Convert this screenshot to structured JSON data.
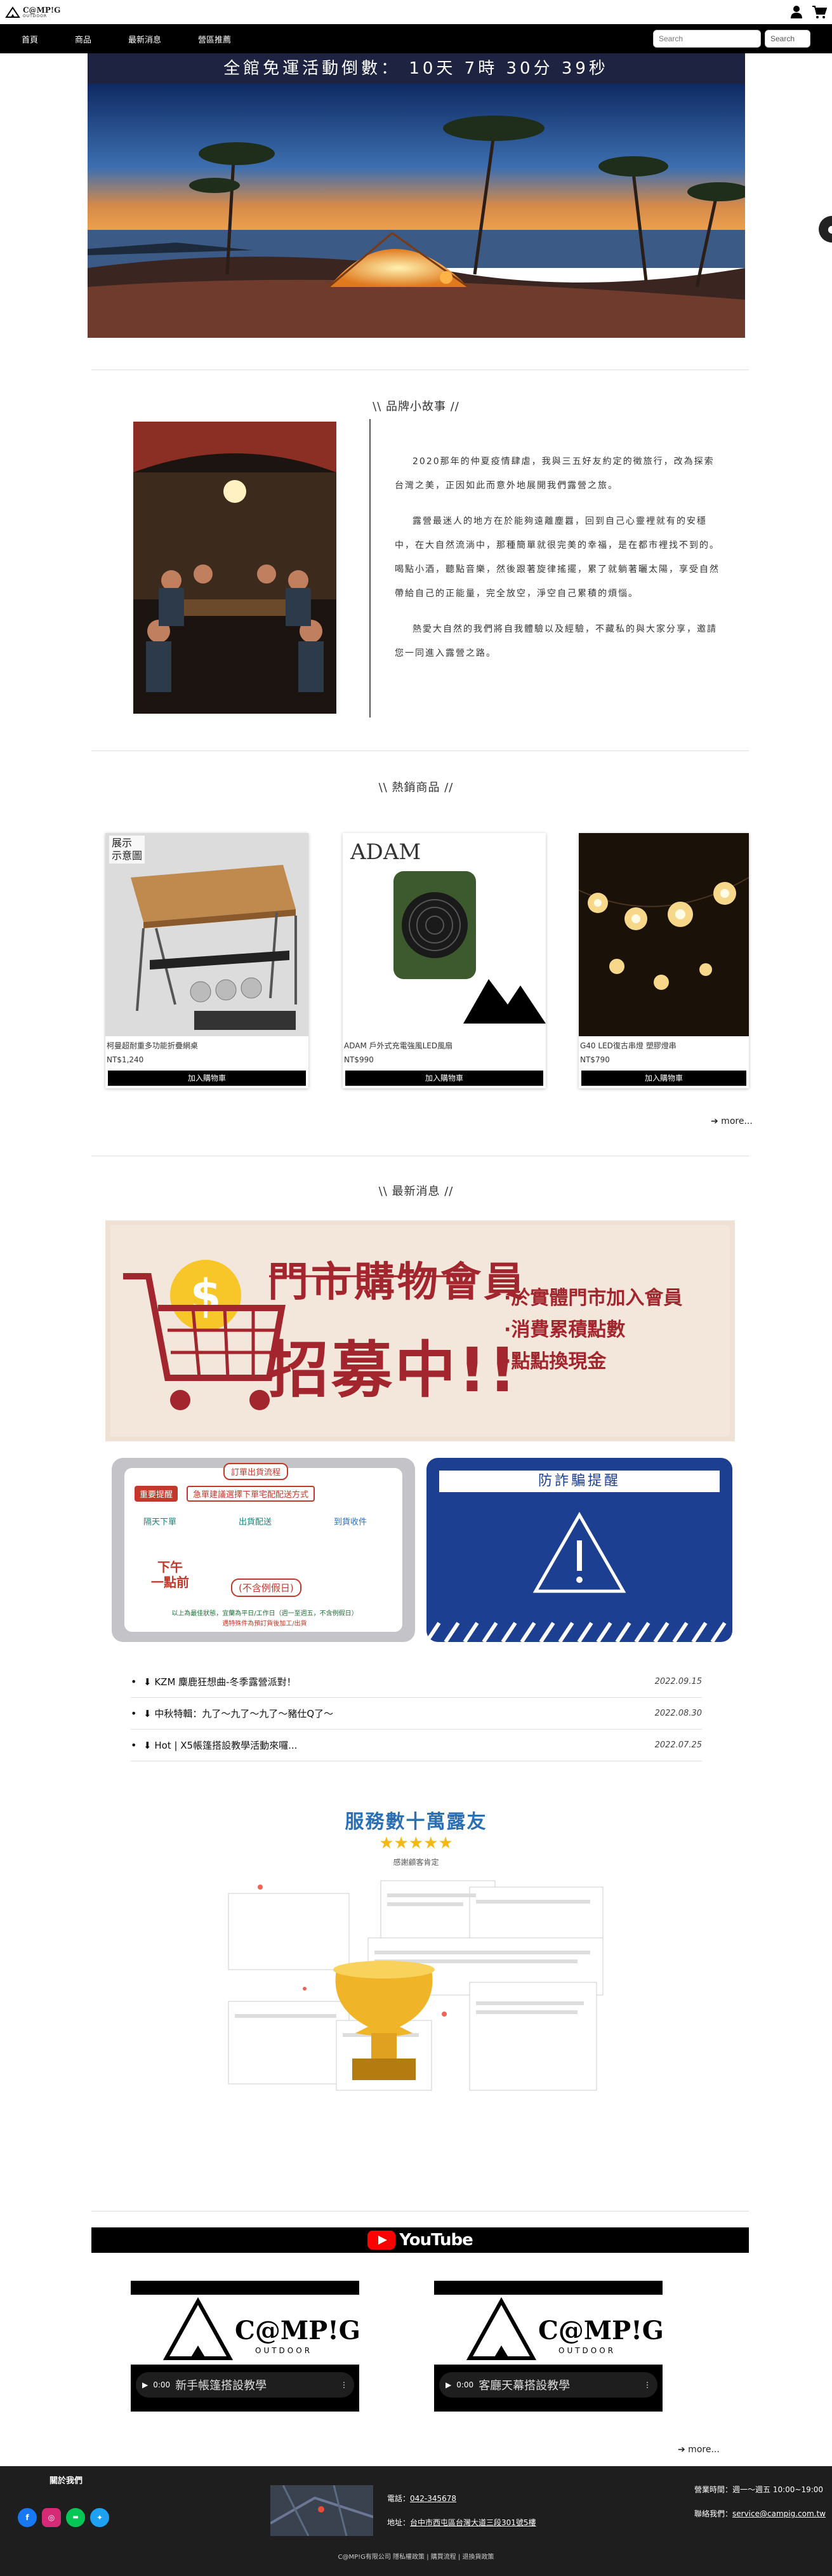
{
  "header": {
    "logo_text": "C@MP!G",
    "logo_sub": "OUTDOOR"
  },
  "nav": {
    "items": [
      "首頁",
      "商品",
      "最新消息",
      "營區推薦"
    ],
    "search_placeholder": "Search",
    "search_button": "Search"
  },
  "countdown": {
    "text": "全館免運活動倒數： 10天 7時 30分 39秒"
  },
  "story": {
    "title": "\\\\ 品牌小故事 //",
    "paragraphs": [
      "2020那年的仲夏疫情肆虐，我與三五好友約定的徵旅行，改為探索台灣之美，正因如此而意外地展開我們露營之旅。",
      "露營最迷人的地方在於能夠遠離塵囂，回到自己心靈裡就有的安穩中，在大自然流淌中，那種簡單就很完美的幸福，是在都市裡找不到的。喝點小酒，聽點音樂，然後跟著旋律搖擺，累了就躺著曬太陽，享受自然帶給自己的正能量，完全放空，淨空自己累積的煩惱。",
      "熱愛大自然的我們將自我體驗以及經驗，不藏私的與大家分享，邀請您一同進入露營之路。"
    ]
  },
  "products": {
    "title": "\\\\ 熱銷商品 //",
    "items": [
      {
        "name": "柯曼超耐重多功能折疊網桌",
        "price": "NT$1,240",
        "button": "加入購物車",
        "badge": "展示\n示意圖"
      },
      {
        "name": "ADAM 戶外式充電強風LED風扇",
        "price": "NT$990",
        "button": "加入購物車",
        "brand": "ADAM"
      },
      {
        "name": "G40 LED復古串燈 塑膠燈串",
        "price": "NT$790",
        "button": "加入購物車"
      }
    ],
    "more": "➔ more..."
  },
  "news": {
    "title": "\\\\ 最新消息 //",
    "member_banner": {
      "title_line1": "門市購物會員",
      "title_line2": "招募中!!",
      "points": [
        "·於實體門市加入會員",
        "·消費累積點數",
        "·點點換現金"
      ]
    },
    "shipping_banner": {
      "tag": "訂單出貨流程",
      "reminder_label": "重要提醒",
      "reminder_text": "急單建議選擇下單宅配配送方式",
      "step1": "隔天下單",
      "step2": "出貨配送",
      "step3": "到貨收件",
      "deadline_l1": "下午",
      "deadline_l2": "一點前",
      "excl": "(不含例假日)",
      "foot1": "以上為最佳狀態，宜蘭為平日/工作日（週一至週五，不含例假日）",
      "foot2": "遇特殊件為預訂貨後加工/出貨"
    },
    "fraud_banner": {
      "title": "防詐騙提醒"
    },
    "items": [
      {
        "text": "⬇ KZM 麋鹿狂想曲-冬季露營派對！",
        "date": "2022.09.15"
      },
      {
        "text": "⬇ 中秋特輯：九了～九了～九了～豬仕Q了～",
        "date": "2022.08.30"
      },
      {
        "text": "⬇ Hot | X5帳篷搭設教學活動來囉...",
        "date": "2022.07.25"
      }
    ]
  },
  "reviews": {
    "title": "服務數十萬露友",
    "subtitle": "感謝顧客肯定"
  },
  "youtube": {
    "brand": "YouTube",
    "videos": [
      {
        "caption": "新手帳篷搭設教學",
        "time": "0:00"
      },
      {
        "caption": "客廳天幕搭設教學",
        "time": "0:00"
      }
    ],
    "more": "➔ more..."
  },
  "footer": {
    "follow": "關於我們",
    "phone_label": "電話：",
    "phone": "042-345678",
    "address_label": "地址：",
    "address": "台中市西屯區台灣大道三段301號5樓",
    "hours_label": "營業時間：",
    "hours": "週一～週五 10:00~19:00",
    "contact_label": "聯絡我們：",
    "email": "service@campig.com.tw",
    "copyright": "C@MP!G有限公司 隱私權政策 | 購買流程 | 退換貨政策"
  },
  "colors": {
    "accent": "#1d2340",
    "dark": "#000000",
    "member_red": "#a3252d",
    "fraud_blue": "#1d3f92"
  }
}
